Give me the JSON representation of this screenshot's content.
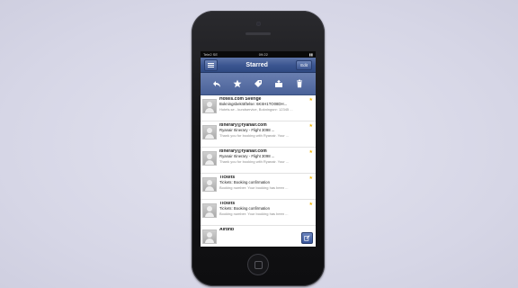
{
  "status_bar": {
    "carrier": "Tele2 SE",
    "time": "09:22",
    "battery": "▮▮"
  },
  "nav": {
    "title": "Starred",
    "edit_label": "Edit"
  },
  "toolbar": {
    "icons": [
      "reply-icon",
      "star-icon",
      "tag-icon",
      "archive-icon",
      "trash-icon"
    ]
  },
  "messages": [
    {
      "sender": "Hotels.com Sverige",
      "subject": "Bokningsbekräftelse: 6KSH1TO08DH...",
      "preview": "Hotels.se - kundservice, Bokningsnr: 12345 ...",
      "starred": true
    },
    {
      "sender": "itinerary@ryanair.com",
      "subject": "Ryanair Itinerary - Flight 3098 ...",
      "preview": "Thank you for booking with Ryanair. Your ...",
      "starred": true
    },
    {
      "sender": "itinerary@ryanair.com",
      "subject": "Ryanair Itinerary - Flight 3098 ...",
      "preview": "Thank you for booking with Ryanair. Your ...",
      "starred": true
    },
    {
      "sender": "Tickets",
      "subject": "Tickets: Booking confirmation",
      "preview": "Booking number: Your booking has been ...",
      "starred": true
    },
    {
      "sender": "Tickets",
      "subject": "Tickets: Booking confirmation",
      "preview": "Booking number: Your booking has been ...",
      "starred": true
    },
    {
      "sender": "Airbnb",
      "subject": "",
      "preview": "",
      "starred": false
    }
  ],
  "colors": {
    "nav_blue": "#3b5590",
    "star_yellow": "#f0b400"
  }
}
